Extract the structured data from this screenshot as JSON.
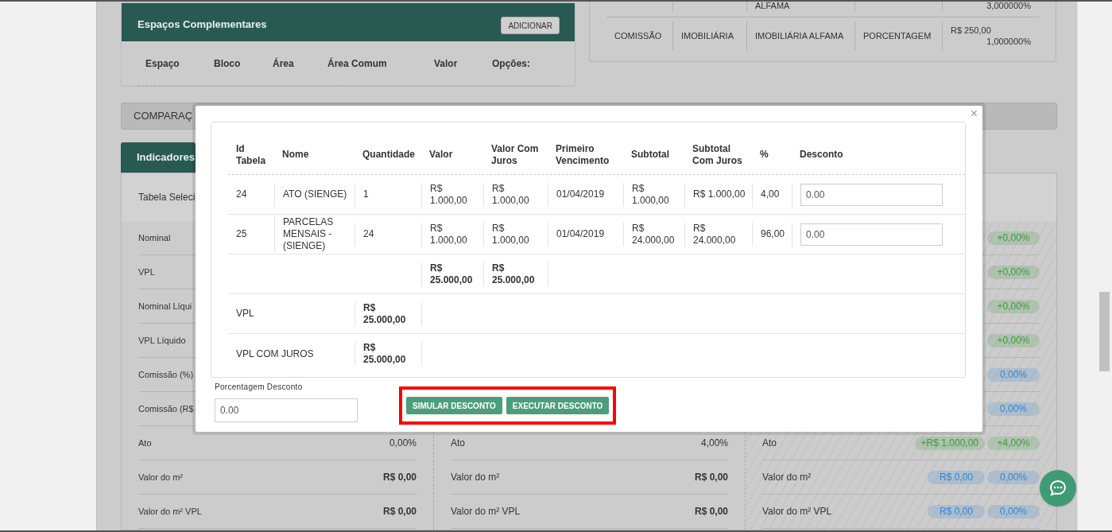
{
  "complementary_spaces": {
    "title": "Espaços Complementares",
    "add_button": "ADICIONAR",
    "columns": [
      "Espaço",
      "Bloco",
      "Área",
      "Área Comum",
      "Valor",
      "Opções:"
    ]
  },
  "commission_table": {
    "rows": [
      {
        "partner": "ALFAMA",
        "rate": "3,000000%"
      },
      {
        "type": "COMISSÃO",
        "beneficiary": "IMOBILIÁRIA",
        "partner": "IMOBILIÁRIA ALFAMA",
        "mode": "PORCENTAGEM",
        "amount": "R$ 250,00",
        "rate": "1,000000%"
      }
    ]
  },
  "comparison_bar": {
    "title": "COMPARAÇ"
  },
  "indicators": {
    "tab": "Indicadores",
    "selected_table_label": "Tabela Seleci",
    "left_rows": [
      {
        "label": "Nominal"
      },
      {
        "label": "VPL"
      },
      {
        "label": "Nominal Líqui"
      },
      {
        "label": "VPL Líquido"
      },
      {
        "label": "Comissão (%)"
      },
      {
        "label": "Comissão (R$"
      },
      {
        "label": "Ato",
        "value": "0,00%",
        "kind": "percent"
      },
      {
        "label": "Valor do m²",
        "value": "R$ 0,00",
        "kind": "currency"
      },
      {
        "label": "Valor do m² VPL",
        "value": "R$ 0,00",
        "kind": "currency"
      }
    ],
    "middle_rows": [
      {
        "label": "Ato",
        "value": "4,00%",
        "kind": "percent"
      },
      {
        "label": "Valor do m²",
        "value": "R$ 0,00",
        "kind": "currency"
      },
      {
        "label": "Valor do m² VPL",
        "value": "R$ 0,00",
        "kind": "currency"
      }
    ],
    "right_rows": [
      {
        "pills": [
          {
            "text": "+0,00%",
            "color": "#3d9a3d"
          }
        ]
      },
      {
        "pills": [
          {
            "text": "+0,00%",
            "color": "#3d9a3d"
          }
        ]
      },
      {
        "pills": [
          {
            "text": "+0,00%",
            "color": "#3d9a3d"
          }
        ]
      },
      {
        "pills": [
          {
            "text": "+0,00%",
            "color": "#3d9a3d"
          }
        ]
      },
      {
        "pills": [
          {
            "text": "0,00%",
            "color": "#2f86d6"
          }
        ]
      },
      {
        "pills": [
          {
            "text": "0,00%",
            "color": "#2f86d6"
          }
        ]
      },
      {
        "label": "Ato",
        "pills": [
          {
            "text": "+R$ 1.000,00",
            "color": "#3d9a3d"
          },
          {
            "text": "+4,00%",
            "color": "#3d9a3d"
          }
        ]
      },
      {
        "label": "Valor do m²",
        "pills": [
          {
            "text": "R$ 0,00",
            "color": "#2f86d6"
          },
          {
            "text": "0,00%",
            "color": "#2f86d6"
          }
        ]
      },
      {
        "label": "Valor do m² VPL",
        "pills": [
          {
            "text": "R$ 0,00",
            "color": "#2f86d6"
          },
          {
            "text": "0,00%",
            "color": "#2f86d6"
          }
        ]
      }
    ]
  },
  "modal": {
    "close_button": "×",
    "table": {
      "columns": [
        "Id Tabela",
        "Nome",
        "Quantidade",
        "Valor",
        "Valor Com Juros",
        "Primeiro Vencimento",
        "Subtotal",
        "Subtotal Com Juros",
        "%",
        "Desconto"
      ],
      "rows": [
        {
          "id": "24",
          "name": "ATO (SIENGE)",
          "quantity": "1",
          "value": "R$ 1.000,00",
          "value_with_interest": "R$ 1.000,00",
          "first_due": "01/04/2019",
          "subtotal": "R$ 1.000,00",
          "subtotal_with_interest": "R$ 1.000,00",
          "percent": "4,00",
          "discount": "0.00"
        },
        {
          "id": "25",
          "name": "PARCELAS MENSAIS - (SIENGE)",
          "quantity": "24",
          "value": "R$ 1.000,00",
          "value_with_interest": "R$ 1.000,00",
          "first_due": "01/04/2019",
          "subtotal": "R$ 24.000,00",
          "subtotal_with_interest": "R$ 24.000,00",
          "percent": "96,00",
          "discount": "0.00"
        }
      ],
      "totals": {
        "value": "R$ 25.000,00",
        "value_with_interest": "R$ 25.000,00"
      },
      "summary": [
        {
          "label": "VPL",
          "value": "R$ 25.000,00"
        },
        {
          "label": "VPL COM JUROS",
          "value": "R$ 25.000,00"
        }
      ]
    },
    "discount_field": {
      "label": "Porcentagem Desconto",
      "value": "0.00"
    },
    "buttons": [
      "SIMULAR DESCONTO",
      "EXECUTAR DESCONTO"
    ]
  }
}
